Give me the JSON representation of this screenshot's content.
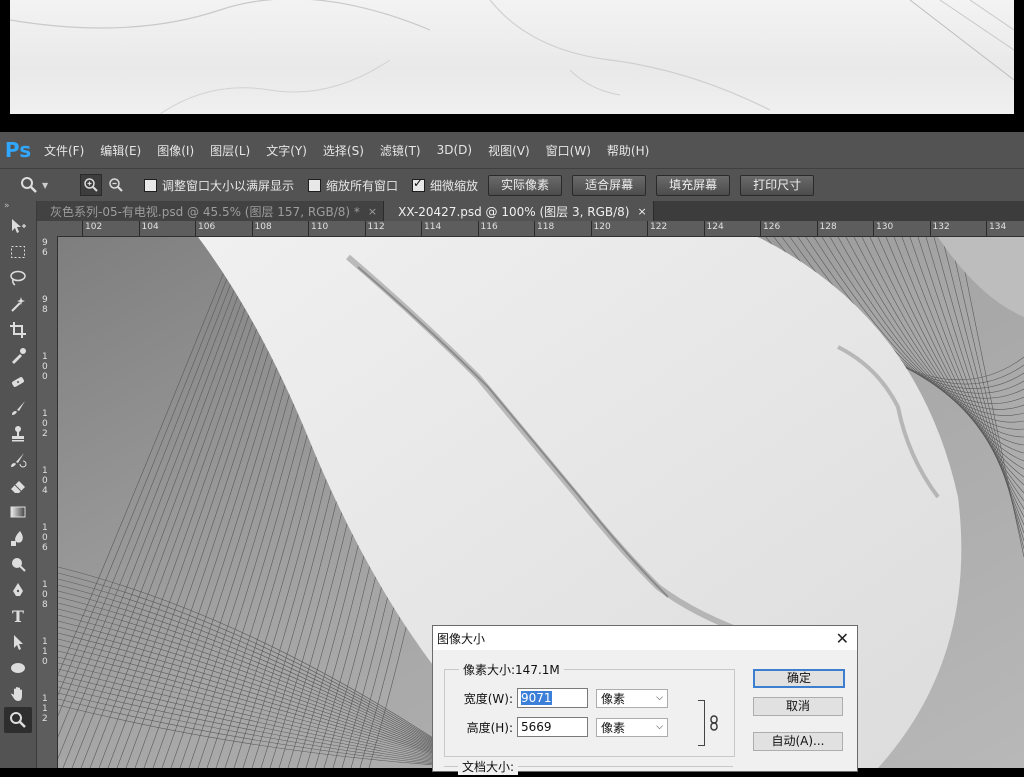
{
  "menubar": {
    "logo": "Ps",
    "items": [
      "文件(F)",
      "编辑(E)",
      "图像(I)",
      "图层(L)",
      "文字(Y)",
      "选择(S)",
      "滤镜(T)",
      "3D(D)",
      "视图(V)",
      "窗口(W)",
      "帮助(H)"
    ]
  },
  "options": {
    "resize_windows": "调整窗口大小以满屏显示",
    "zoom_all_windows": "缩放所有窗口",
    "scrubby_zoom": "细微缩放",
    "buttons": [
      "实际像素",
      "适合屏幕",
      "填充屏幕",
      "打印尺寸"
    ]
  },
  "tabs": [
    {
      "label": "灰色系列-05-有电视.psd @ 45.5% (图层 157, RGB/8) *",
      "close": "×"
    },
    {
      "label": "XX-20427.psd @ 100% (图层 3, RGB/8)",
      "close": "×"
    }
  ],
  "ruler": {
    "top": [
      "102",
      "104",
      "106",
      "108",
      "110",
      "112",
      "114",
      "116",
      "118",
      "120",
      "122",
      "124",
      "126",
      "128",
      "130",
      "132",
      "134"
    ],
    "left": [
      "96",
      "98",
      "100",
      "102",
      "104",
      "106",
      "108",
      "110",
      "112"
    ]
  },
  "dialog": {
    "title": "图像大小",
    "close": "✕",
    "pixel_dimensions": "像素大小:147.1M",
    "width_label": "宽度(W):",
    "width_value": "9071",
    "width_unit": "像素",
    "height_label": "高度(H):",
    "height_value": "5669",
    "height_unit": "像素",
    "ok": "确定",
    "cancel": "取消",
    "auto": "自动(A)...",
    "document_size": "文档大小:"
  },
  "colors": {
    "accent": "#31a8ff",
    "panel": "#535353"
  }
}
